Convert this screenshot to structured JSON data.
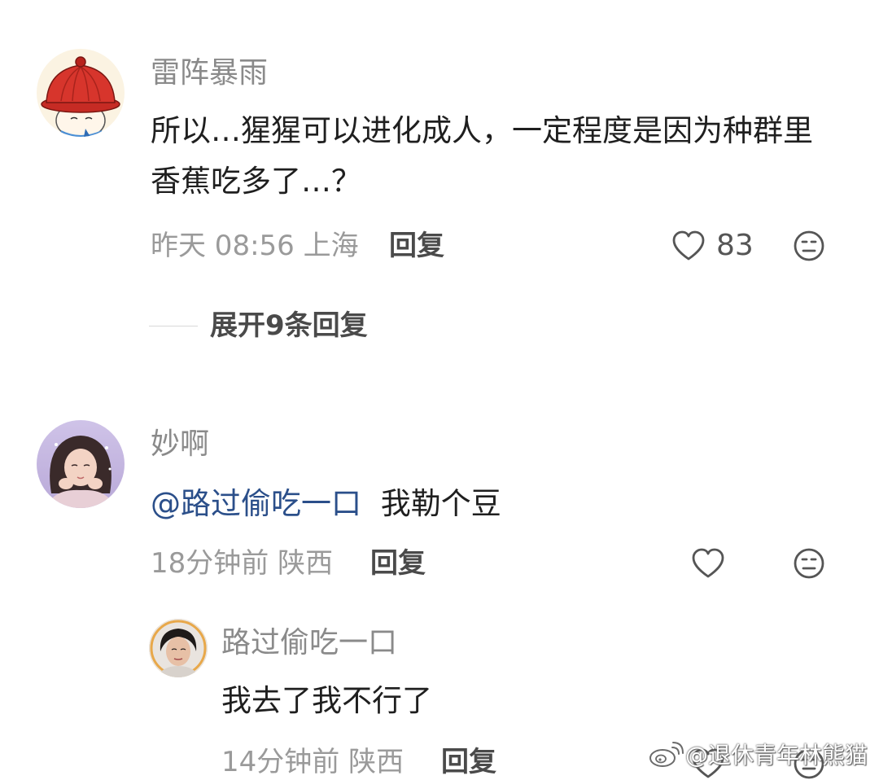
{
  "comments": [
    {
      "username": "雷阵暴雨",
      "content": "所以…猩猩可以进化成人，一定程度是因为种群里香蕉吃多了…？",
      "time": "昨天 08:56",
      "location": "上海",
      "reply_label": "回复",
      "likes": "83",
      "expand_label": "展开9条回复",
      "avatar_icon": "red-hat-cartoon-avatar"
    },
    {
      "username": "妙啊",
      "mention": "@路过偷吃一口",
      "content": "我勒个豆",
      "time": "18分钟前",
      "location": "陕西",
      "reply_label": "回复",
      "avatar_icon": "girl-photo-avatar"
    }
  ],
  "sub_reply": {
    "username": "路过偷吃一口",
    "content": "我去了我不行了",
    "time": "14分钟前",
    "location": "陕西",
    "reply_label": "回复",
    "avatar_icon": "woman-photo-avatar"
  },
  "watermark": {
    "text": "@退休青年林熊猫",
    "icon": "weibo-logo-icon"
  },
  "colors": {
    "mention": "#2b4f8a",
    "username": "#8a8a8a",
    "meta": "#9a9a9a",
    "text": "#1f1f1f"
  }
}
